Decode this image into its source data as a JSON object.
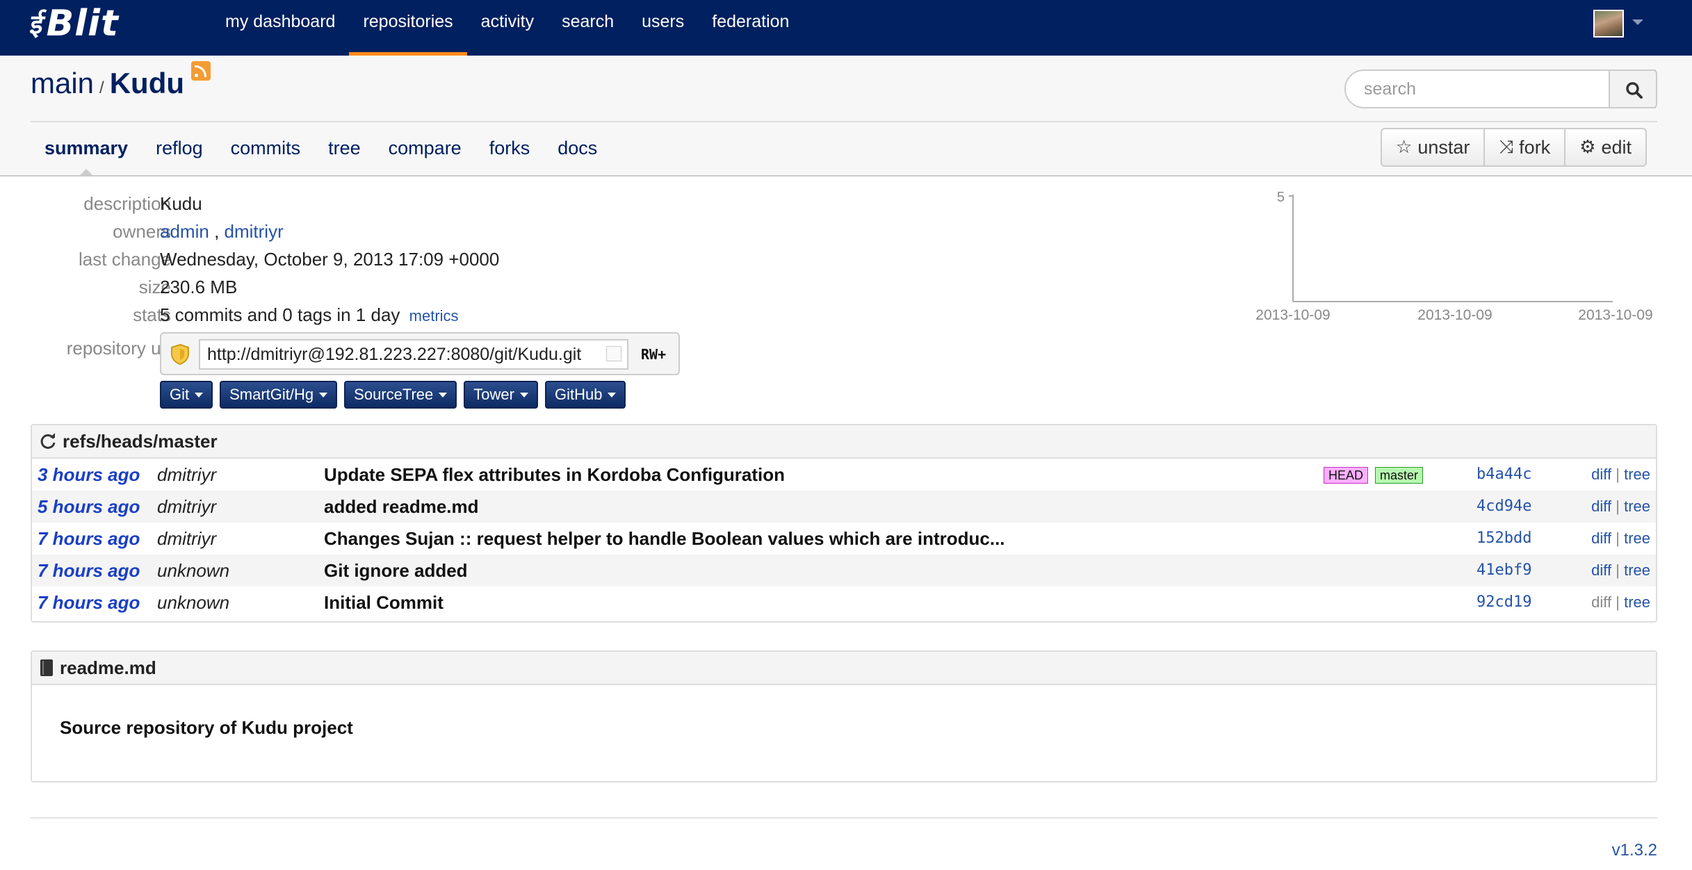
{
  "brand": {
    "name": "Blit"
  },
  "nav": {
    "items": [
      {
        "label": "my dashboard"
      },
      {
        "label": "repositories"
      },
      {
        "label": "activity"
      },
      {
        "label": "search"
      },
      {
        "label": "users"
      },
      {
        "label": "federation"
      }
    ],
    "active_index": 1
  },
  "repo": {
    "project": "main",
    "separator": "/",
    "name": "Kudu"
  },
  "search": {
    "placeholder": "search"
  },
  "tabs": [
    {
      "label": "summary"
    },
    {
      "label": "reflog"
    },
    {
      "label": "commits"
    },
    {
      "label": "tree"
    },
    {
      "label": "compare"
    },
    {
      "label": "forks"
    },
    {
      "label": "docs"
    }
  ],
  "actions": {
    "unstar": "unstar",
    "fork": "fork",
    "edit": "edit"
  },
  "info": {
    "description_label": "description",
    "description_value": "Kudu",
    "owners_label": "owners",
    "owner1": "admin",
    "owners_sep": ",",
    "owner2": "dmitriyr",
    "last_change_label": "last change",
    "last_change_value": "Wednesday, October 9, 2013 17:09 +0000",
    "size_label": "size",
    "size_value": "230.6 MB",
    "stats_label": "stats",
    "stats_value": "5 commits and 0 tags in 1 day",
    "metrics_link": "metrics",
    "url_label": "repository url",
    "url_value": "http://dmitriyr@192.81.223.227:8080/git/Kudu.git",
    "permission": "RW+"
  },
  "clone_apps": [
    {
      "label": "Git"
    },
    {
      "label": "SmartGit/Hg"
    },
    {
      "label": "SourceTree"
    },
    {
      "label": "Tower"
    },
    {
      "label": "GitHub"
    }
  ],
  "chart_data": {
    "type": "line",
    "x": [
      "2013-10-09",
      "2013-10-09",
      "2013-10-09"
    ],
    "ytick": "5"
  },
  "commits": {
    "ref": "refs/heads/master",
    "rows": [
      {
        "date": "3 hours ago",
        "author": "dmitriyr",
        "message": "Update SEPA flex attributes in Kordoba Configuration",
        "sha": "b4a44c",
        "diff": "diff",
        "tree": "tree",
        "ref_head": "HEAD",
        "ref_master": "master"
      },
      {
        "date": "5 hours ago",
        "author": "dmitriyr",
        "message": "added readme.md",
        "sha": "4cd94e",
        "diff": "diff",
        "tree": "tree"
      },
      {
        "date": "7 hours ago",
        "author": "dmitriyr",
        "message": "Changes Sujan :: request helper to handle Boolean values which are introduc...",
        "sha": "152bdd",
        "diff": "diff",
        "tree": "tree"
      },
      {
        "date": "7 hours ago",
        "author": "unknown",
        "message": "Git ignore added",
        "sha": "41ebf9",
        "diff": "diff",
        "tree": "tree"
      },
      {
        "date": "7 hours ago",
        "author": "unknown",
        "message": "Initial Commit",
        "sha": "92cd19",
        "diff": "diff",
        "tree": "tree"
      }
    ],
    "link_sep": "|"
  },
  "readme": {
    "filename": "readme.md",
    "content": "Source repository of Kudu project"
  },
  "footer": {
    "version": "v1.3.2"
  }
}
